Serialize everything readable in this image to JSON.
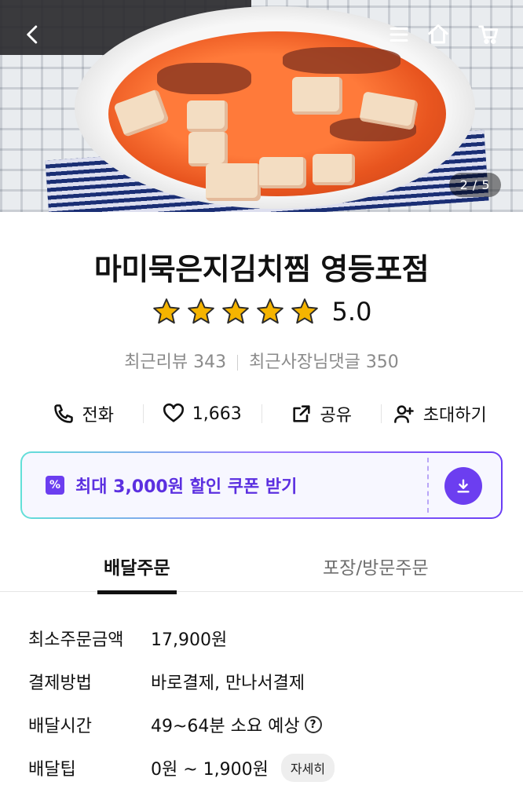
{
  "hero": {
    "image_counter": "2 / 5"
  },
  "store": {
    "name": "마미묵은지김치찜 영등포점",
    "rating": "5.0",
    "stars": 5,
    "recent_reviews": "최근리뷰 343",
    "owner_replies": "최근사장님댓글 350"
  },
  "actions": {
    "call": "전화",
    "likes": "1,663",
    "share": "공유",
    "invite": "초대하기"
  },
  "coupon": {
    "text": "최대 3,000원 할인 쿠폰 받기"
  },
  "tabs": {
    "delivery": "배달주문",
    "pickup": "포장/방문주문"
  },
  "info": {
    "rows": [
      {
        "label": "최소주문금액",
        "value": "17,900원"
      },
      {
        "label": "결제방법",
        "value": "바로결제, 만나서결제"
      },
      {
        "label": "배달시간",
        "value": "49~64분 소요 예상"
      },
      {
        "label": "배달팁",
        "value": "0원 ~ 1,900원"
      }
    ],
    "detail_button": "자세히"
  },
  "colors": {
    "accent": "#6c3ef0",
    "star": "#f5b400"
  }
}
